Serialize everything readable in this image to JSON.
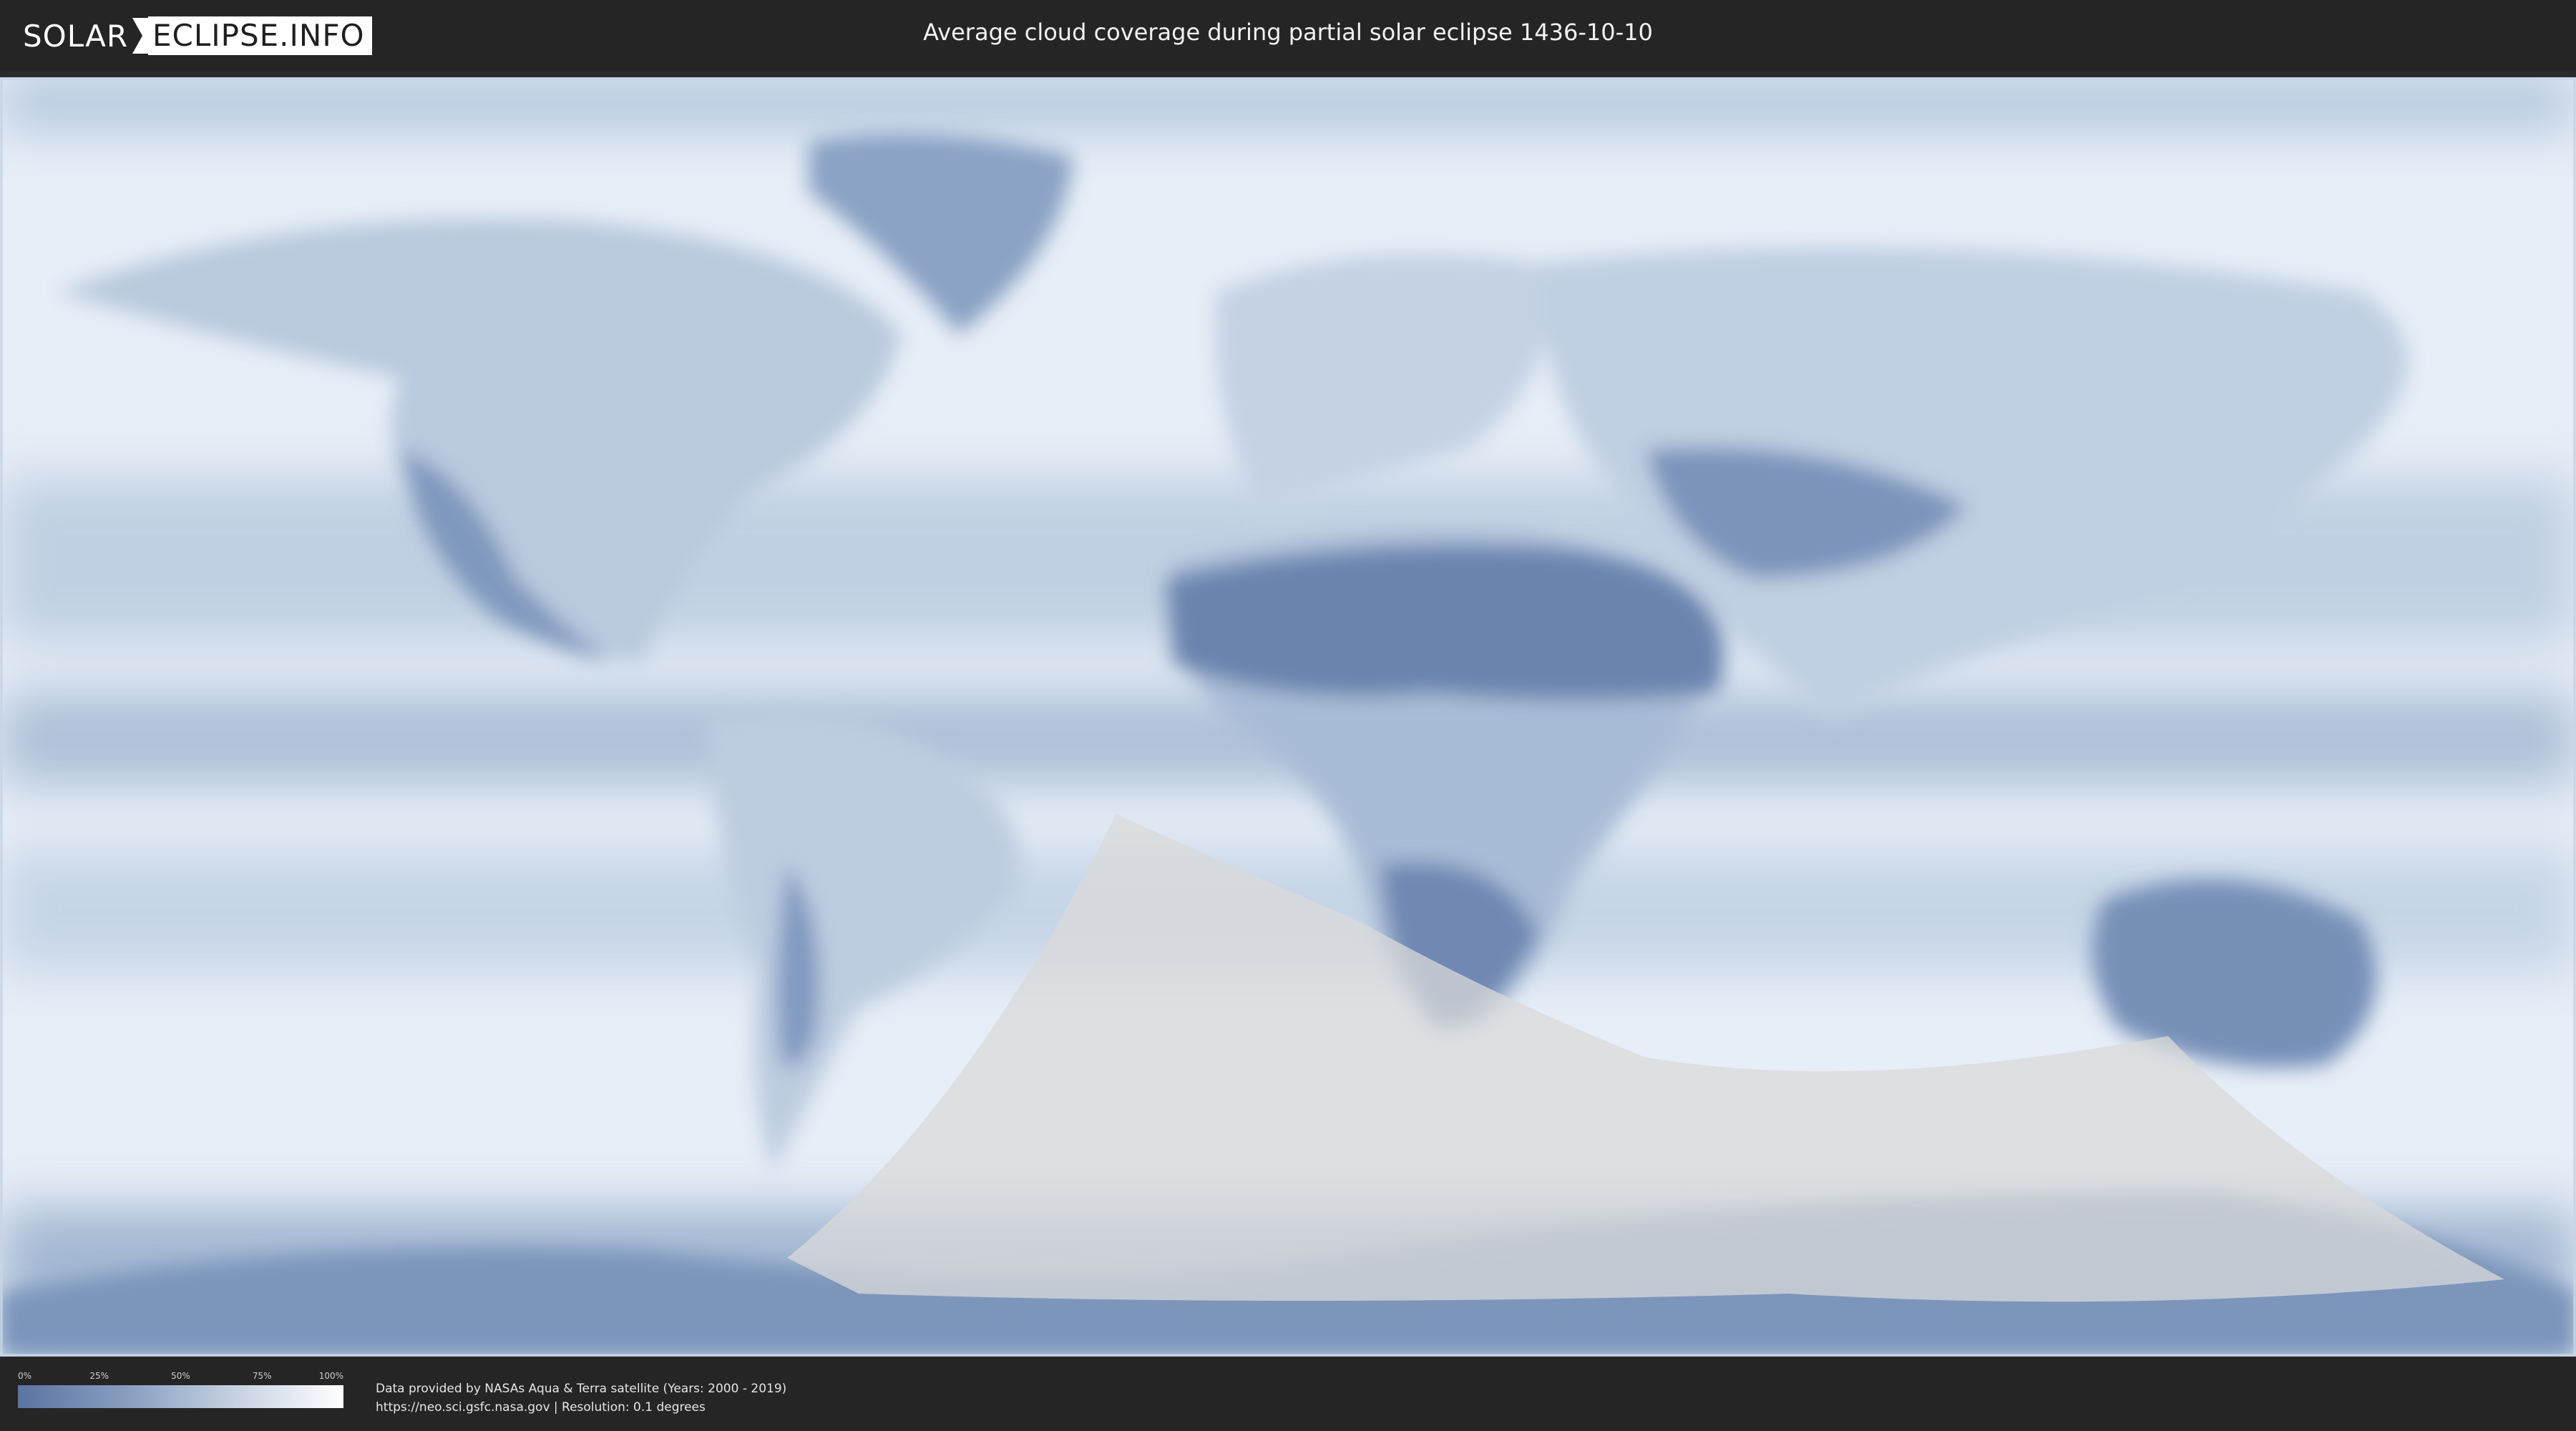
{
  "header": {
    "logo_left": "SOLAR",
    "logo_right": "ECLIPSE.INFO",
    "title": "Average cloud coverage during partial solar eclipse 1436-10-10"
  },
  "legend": {
    "ticks": [
      "0%",
      "25%",
      "50%",
      "75%",
      "100%"
    ],
    "color_low": "#5b74a1",
    "color_high": "#ffffff"
  },
  "footer": {
    "line1": "Data provided by NASAs Aqua & Terra satellite (Years: 2000 - 2019)",
    "line2": "https://neo.sci.gsfc.nasa.gov | Resolution: 0.1 degrees"
  },
  "colors": {
    "cloud_white": "#f4f7fb",
    "clear_blue": "#6a84b0",
    "eclipse_overlay": "#d9d9d9"
  }
}
